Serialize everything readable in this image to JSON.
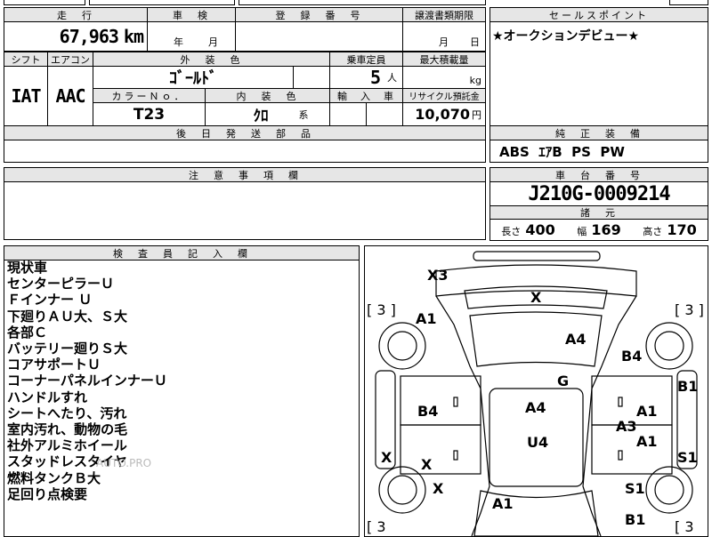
{
  "top": {
    "mileage_header": "走　行",
    "mileage_value": "67,963",
    "mileage_unit": "km",
    "inspection_header": "車　検",
    "inspection_year": "年",
    "inspection_month": "月",
    "reg_header": "登　録　番　号",
    "transfer_header": "譲渡書類期限",
    "transfer_month": "月",
    "transfer_day": "日",
    "sales_header": "セールスポイント",
    "sales_text": "★オークションデビュー★"
  },
  "row2": {
    "shift_header": "シフト",
    "shift_value": "IAT",
    "ac_header": "エアコン",
    "ac_value": "AAC",
    "color_header": "外　装　色",
    "color_value": "ｺﾞｰﾙﾄﾞ",
    "capacity_header": "乗車定員",
    "capacity_value": "5",
    "capacity_unit": "人",
    "maxload_header": "最大積載量",
    "maxload_unit": "kg",
    "colorno_header": "カラーＮｏ．",
    "colorno_value": "T23",
    "interior_header": "内　装　色",
    "interior_value": "ｸﾛ",
    "interior_unit": "系",
    "import_header": "輸　入　車",
    "recycle_header": "リサイクル預託金",
    "recycle_value": "10,070",
    "recycle_unit": "円"
  },
  "shipping": {
    "header": "後　日　発　送　部　品"
  },
  "equipment": {
    "header": "純　正　装　備",
    "value": "ABS  ｴｱB  PS  PW"
  },
  "caution": {
    "header": "注　意　事　項　欄"
  },
  "chassis": {
    "header": "車　台　番　号",
    "value": "J210G-0009214",
    "spec_header": "諸　元",
    "length_label": "長さ",
    "length_value": "400",
    "width_label": "幅",
    "width_value": "169",
    "height_label": "高さ",
    "height_value": "170"
  },
  "inspector": {
    "header": "検　査　員　記　入　欄",
    "notes": [
      "現状車",
      "センターピラーＵ",
      "Ｆインナー Ｕ",
      "下廻りＡＵ大、Ｓ大",
      "各部Ｃ",
      "バッテリー廻りＳ大",
      "コアサポートＵ",
      "コーナーパネルインナーＵ",
      "ハンドルすれ",
      "シートへたり、汚れ",
      "室内汚れ、動物の毛",
      "社外アルミホイール",
      "スタッドレスタイヤ",
      "燃料タンクＢ大",
      "足回り点検要"
    ]
  },
  "diagram": {
    "tire_left_top": "[ 3 ]",
    "tire_right_top": "[ 3 ]",
    "tire_left_bottom": "[ 3",
    "tire_right_bottom": "[ 3",
    "marks": {
      "X3": "X3",
      "X_hood": "X",
      "A1_front_left": "A1",
      "A4_front": "A4",
      "B4_right": "B4",
      "B1_right_rail": "B1",
      "G": "G",
      "B4_left": "B4",
      "A4_roof": "A4",
      "A1_right_door1": "A1",
      "A3": "A3",
      "A1_right_door2": "A1",
      "U4": "U4",
      "X_left_rail": "X",
      "X_left_door": "X",
      "S1_right_rail": "S1",
      "X_left_rear": "X",
      "S1_right_rear": "S1",
      "A1_rear": "A1",
      "B1_rear": "B1"
    }
  },
  "watermark": "AUTO.PRO"
}
